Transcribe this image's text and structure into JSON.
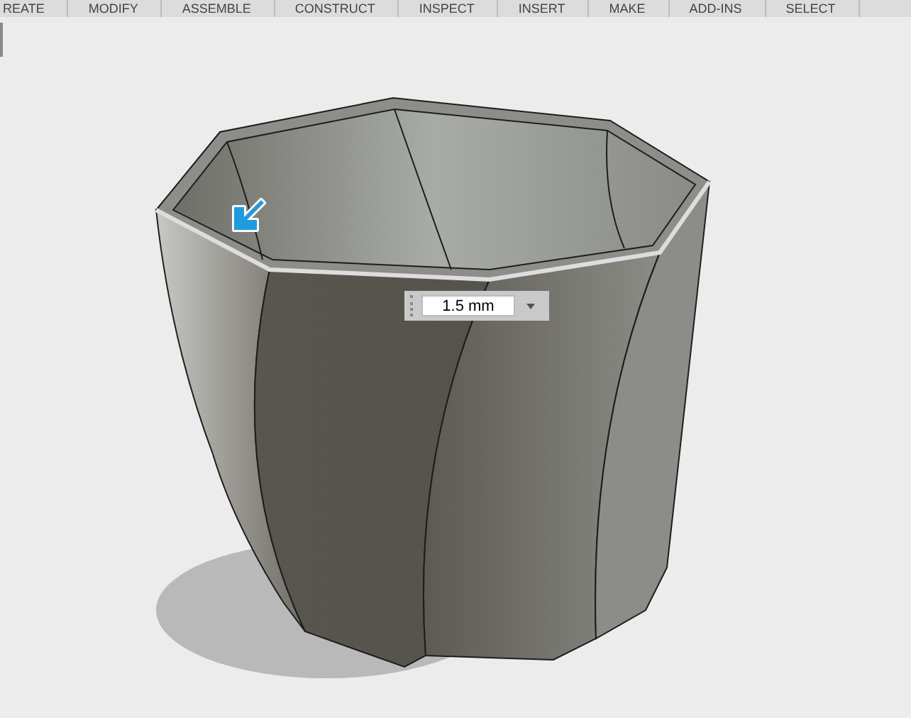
{
  "toolbar": {
    "tabs": [
      {
        "label": "REATE"
      },
      {
        "label": "MODIFY"
      },
      {
        "label": "ASSEMBLE"
      },
      {
        "label": "CONSTRUCT"
      },
      {
        "label": "INSPECT"
      },
      {
        "label": "INSERT"
      },
      {
        "label": "MAKE"
      },
      {
        "label": "ADD-INS"
      },
      {
        "label": "SELECT"
      }
    ]
  },
  "dimension_input": {
    "value": "1.5 mm"
  }
}
